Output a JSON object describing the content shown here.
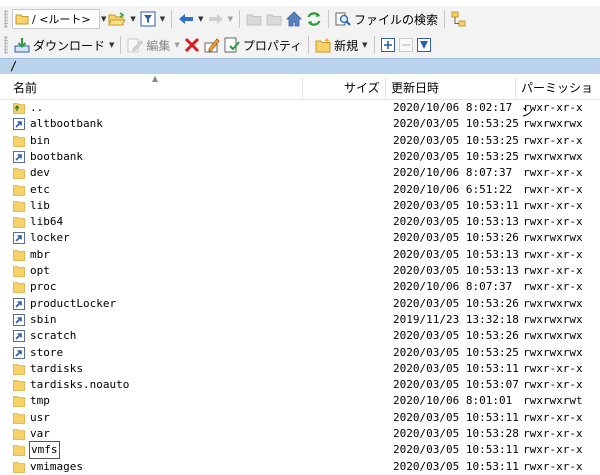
{
  "toolbar1": {
    "path_combo": "/ <ルート>",
    "find_files_label": "ファイルの検索"
  },
  "toolbar2": {
    "download_label": "ダウンロード",
    "edit_label": "編集",
    "properties_label": "プロパティ",
    "new_label": "新規"
  },
  "address": {
    "path": "/"
  },
  "columns": {
    "name": "名前",
    "size": "サイズ",
    "modified": "更新日時",
    "permissions": "パーミッション"
  },
  "files": [
    {
      "name": "..",
      "modified": "2020/10/06 8:02:17",
      "perms": "rwxr-xr-x",
      "icon": "up-folder-icon"
    },
    {
      "name": "altbootbank",
      "modified": "2020/03/05 10:53:25",
      "perms": "rwxrwxrwx",
      "icon": "symlink-icon"
    },
    {
      "name": "bin",
      "modified": "2020/03/05 10:53:25",
      "perms": "rwxr-xr-x",
      "icon": "folder-icon"
    },
    {
      "name": "bootbank",
      "modified": "2020/03/05 10:53:25",
      "perms": "rwxrwxrwx",
      "icon": "symlink-icon"
    },
    {
      "name": "dev",
      "modified": "2020/10/06 8:07:37",
      "perms": "rwxr-xr-x",
      "icon": "folder-icon"
    },
    {
      "name": "etc",
      "modified": "2020/10/06 6:51:22",
      "perms": "rwxr-xr-x",
      "icon": "folder-icon"
    },
    {
      "name": "lib",
      "modified": "2020/03/05 10:53:11",
      "perms": "rwxr-xr-x",
      "icon": "folder-icon"
    },
    {
      "name": "lib64",
      "modified": "2020/03/05 10:53:13",
      "perms": "rwxr-xr-x",
      "icon": "folder-icon"
    },
    {
      "name": "locker",
      "modified": "2020/03/05 10:53:26",
      "perms": "rwxrwxrwx",
      "icon": "symlink-icon"
    },
    {
      "name": "mbr",
      "modified": "2020/03/05 10:53:13",
      "perms": "rwxr-xr-x",
      "icon": "folder-icon"
    },
    {
      "name": "opt",
      "modified": "2020/03/05 10:53:13",
      "perms": "rwxr-xr-x",
      "icon": "folder-icon"
    },
    {
      "name": "proc",
      "modified": "2020/10/06 8:07:37",
      "perms": "rwxr-xr-x",
      "icon": "folder-icon"
    },
    {
      "name": "productLocker",
      "modified": "2020/03/05 10:53:26",
      "perms": "rwxrwxrwx",
      "icon": "symlink-icon"
    },
    {
      "name": "sbin",
      "modified": "2019/11/23 13:32:18",
      "perms": "rwxrwxrwx",
      "icon": "symlink-icon"
    },
    {
      "name": "scratch",
      "modified": "2020/03/05 10:53:26",
      "perms": "rwxrwxrwx",
      "icon": "symlink-icon"
    },
    {
      "name": "store",
      "modified": "2020/03/05 10:53:25",
      "perms": "rwxrwxrwx",
      "icon": "symlink-icon"
    },
    {
      "name": "tardisks",
      "modified": "2020/03/05 10:53:11",
      "perms": "rwxr-xr-x",
      "icon": "folder-icon"
    },
    {
      "name": "tardisks.noauto",
      "modified": "2020/03/05 10:53:07",
      "perms": "rwxr-xr-x",
      "icon": "folder-icon"
    },
    {
      "name": "tmp",
      "modified": "2020/10/06 8:01:01",
      "perms": "rwxrwxrwt",
      "icon": "folder-icon"
    },
    {
      "name": "usr",
      "modified": "2020/03/05 10:53:11",
      "perms": "rwxr-xr-x",
      "icon": "folder-icon"
    },
    {
      "name": "var",
      "modified": "2020/03/05 10:53:28",
      "perms": "rwxr-xr-x",
      "icon": "folder-icon"
    },
    {
      "name": "vmfs",
      "modified": "2020/03/05 10:53:11",
      "perms": "rwxr-xr-x",
      "icon": "folder-icon"
    },
    {
      "name": "vmimages",
      "modified": "2020/03/05 10:53:11",
      "perms": "rwxr-xr-x",
      "icon": "folder-icon"
    }
  ],
  "colors": {
    "address_bar": "#bcd3ec",
    "folder": "#f6d268",
    "symlink_arrow": "#2f5fa8",
    "delete": "#d42020",
    "refresh": "#2a9a3a"
  }
}
